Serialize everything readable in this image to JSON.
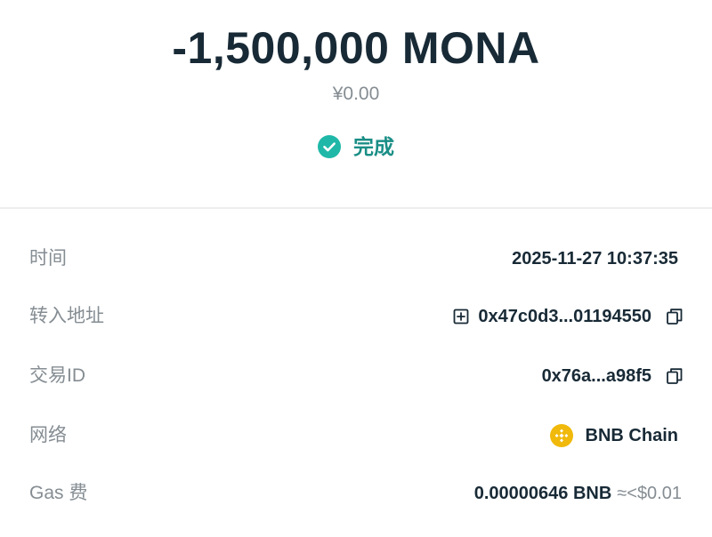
{
  "header": {
    "amount": "-1,500,000 MONA",
    "fiat_value": "¥0.00",
    "status": "完成"
  },
  "details": {
    "time": {
      "label": "时间",
      "value": "2025-11-27 10:37:35"
    },
    "to_address": {
      "label": "转入地址",
      "value": "0x47c0d3...01194550"
    },
    "tx_id": {
      "label": "交易ID",
      "value": "0x76a...a98f5"
    },
    "network": {
      "label": "网络",
      "value": "BNB Chain"
    },
    "gas": {
      "label": "Gas 费",
      "value": "0.00000646 BNB",
      "approx": "≈<$0.01"
    }
  },
  "colors": {
    "status_green": "#1fb8a8",
    "bnb_yellow": "#f0b90b",
    "text_dark": "#182a36",
    "text_muted": "#858d93"
  },
  "icons": {
    "status": "check-circle-icon",
    "address_add": "plus-square-icon",
    "copy": "copy-icon",
    "network": "bnb-logo-icon"
  }
}
